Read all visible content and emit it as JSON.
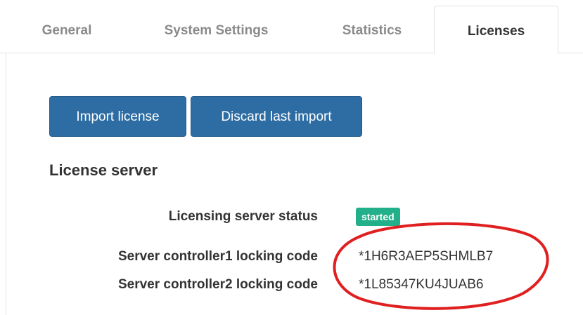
{
  "tabs": [
    {
      "label": "General"
    },
    {
      "label": "System Settings"
    },
    {
      "label": "Statistics"
    },
    {
      "label": "Licenses"
    }
  ],
  "actions": {
    "import_label": "Import license",
    "discard_label": "Discard last import"
  },
  "license_server": {
    "title": "License server",
    "status_label": "Licensing server status",
    "status_value": "started",
    "status_color": "#21b089",
    "controller1_label": "Server controller1 locking code",
    "controller1_code": "*1H6R3AEP5SHMLB7",
    "controller2_label": "Server controller2 locking code",
    "controller2_code": "*1L85347KU4JUAB6"
  },
  "colors": {
    "primary_button": "#2e6da4",
    "annotation": "#e02020"
  }
}
